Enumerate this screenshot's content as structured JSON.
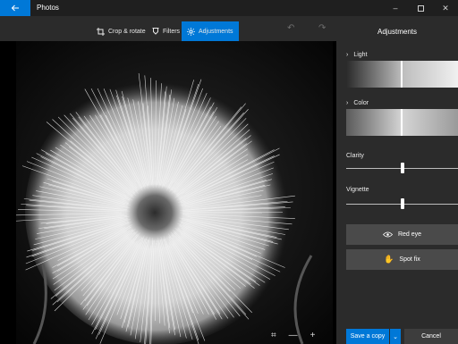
{
  "window": {
    "title": "Photos"
  },
  "toolbar": {
    "crop_rotate_label": "Crop & rotate",
    "filters_label": "Filters",
    "adjustments_label": "Adjustments"
  },
  "panel": {
    "title": "Adjustments",
    "light_label": "Light",
    "color_label": "Color",
    "clarity_label": "Clarity",
    "clarity_value": 0.5,
    "vignette_label": "Vignette",
    "vignette_value": 0.5,
    "red_eye_label": "Red eye",
    "spot_fix_label": "Spot fix"
  },
  "actions": {
    "save_copy_label": "Save a copy",
    "cancel_label": "Cancel"
  },
  "colors": {
    "accent": "#0078d7",
    "panel_bg": "#2b2b2b",
    "button_bg": "#4a4a4a"
  },
  "icons": {
    "back": "arrow-left-icon",
    "minimize": "minimize-icon",
    "maximize": "maximize-icon",
    "close": "close-icon",
    "crop": "crop-icon",
    "filters": "filter-icon",
    "adjustments": "brightness-icon",
    "undo": "undo-icon",
    "redo": "redo-icon",
    "fit": "fit-screen-icon",
    "zoom_out": "zoom-out-icon",
    "zoom_in": "zoom-in-icon",
    "eye": "eye-icon",
    "hand": "hand-icon"
  }
}
